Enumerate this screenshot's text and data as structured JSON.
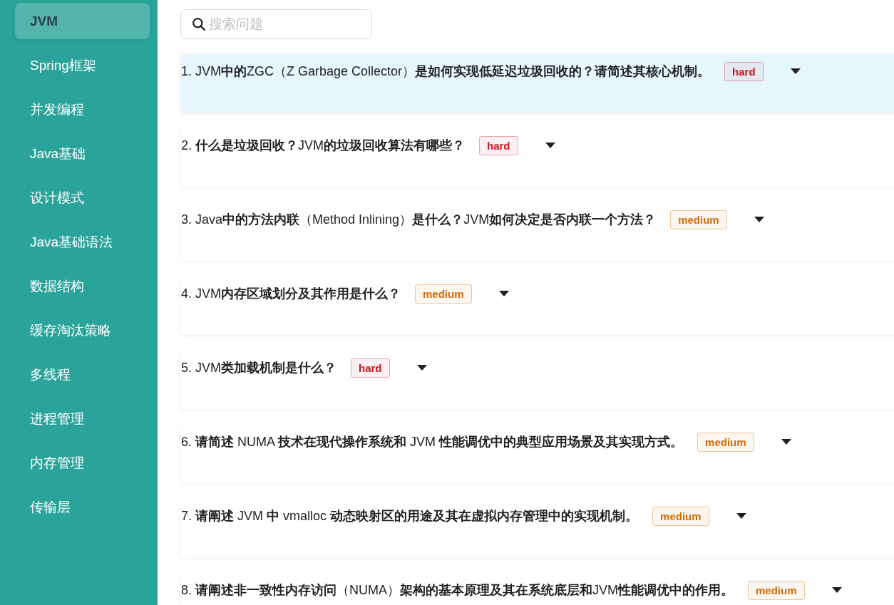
{
  "sidebar": {
    "items": [
      {
        "label": "JVM",
        "selected": true
      },
      {
        "label": "Spring框架",
        "selected": false
      },
      {
        "label": "并发编程",
        "selected": false
      },
      {
        "label": "Java基础",
        "selected": false
      },
      {
        "label": "设计模式",
        "selected": false
      },
      {
        "label": "Java基础语法",
        "selected": false
      },
      {
        "label": "数据结构",
        "selected": false
      },
      {
        "label": "缓存淘汰策略",
        "selected": false
      },
      {
        "label": "多线程",
        "selected": false
      },
      {
        "label": "进程管理",
        "selected": false
      },
      {
        "label": "内存管理",
        "selected": false
      },
      {
        "label": "传输层",
        "selected": false
      }
    ]
  },
  "search": {
    "placeholder": "搜索问题"
  },
  "questions": [
    {
      "title": "1. JVM**中的**ZGC（Z Garbage Collector）**是如何实现低延迟垃圾回收的？请简述其核心机制。**",
      "selected": true,
      "tag": {
        "label": "hard",
        "color": "#cf1322"
      }
    },
    {
      "title": "2. **什么是垃圾回收？**JVM**的垃圾回收算法有哪些？**",
      "selected": false,
      "tag": {
        "label": "hard",
        "color": "#cf1322"
      }
    },
    {
      "title": "3. Java**中的方法内联**（Method Inlining）**是什么？**JVM**如何决定是否内联一个方法？**",
      "selected": false,
      "tag": {
        "label": "medium",
        "color": "#d46b08"
      }
    },
    {
      "title": "4. JVM**内存区域划分及其作用是什么？**",
      "selected": false,
      "tag": {
        "label": "medium",
        "color": "#d46b08"
      }
    },
    {
      "title": "5. JVM**类加载机制是什么？**",
      "selected": false,
      "tag": {
        "label": "hard",
        "color": "#cf1322"
      }
    },
    {
      "title": "6. **请简述** NUMA **技术在现代操作系统和** JVM **性能调优中的典型应用场景及其实现方式。**",
      "selected": false,
      "tag": {
        "label": "medium",
        "color": "#d46b08"
      }
    },
    {
      "title": "7. **请阐述** JVM **中** vmalloc **动态映射区的用途及其在虚拟内存管理中的实现机制。**",
      "selected": false,
      "tag": {
        "label": "medium",
        "color": "#d46b08"
      }
    },
    {
      "title": "8. **请阐述非一致性内存访问**（NUMA）**架构的基本原理及其在系统底层和**JVM**性能调优中的作用。**",
      "selected": false,
      "tag": {
        "label": "medium",
        "color": "#d46b08"
      }
    }
  ]
}
